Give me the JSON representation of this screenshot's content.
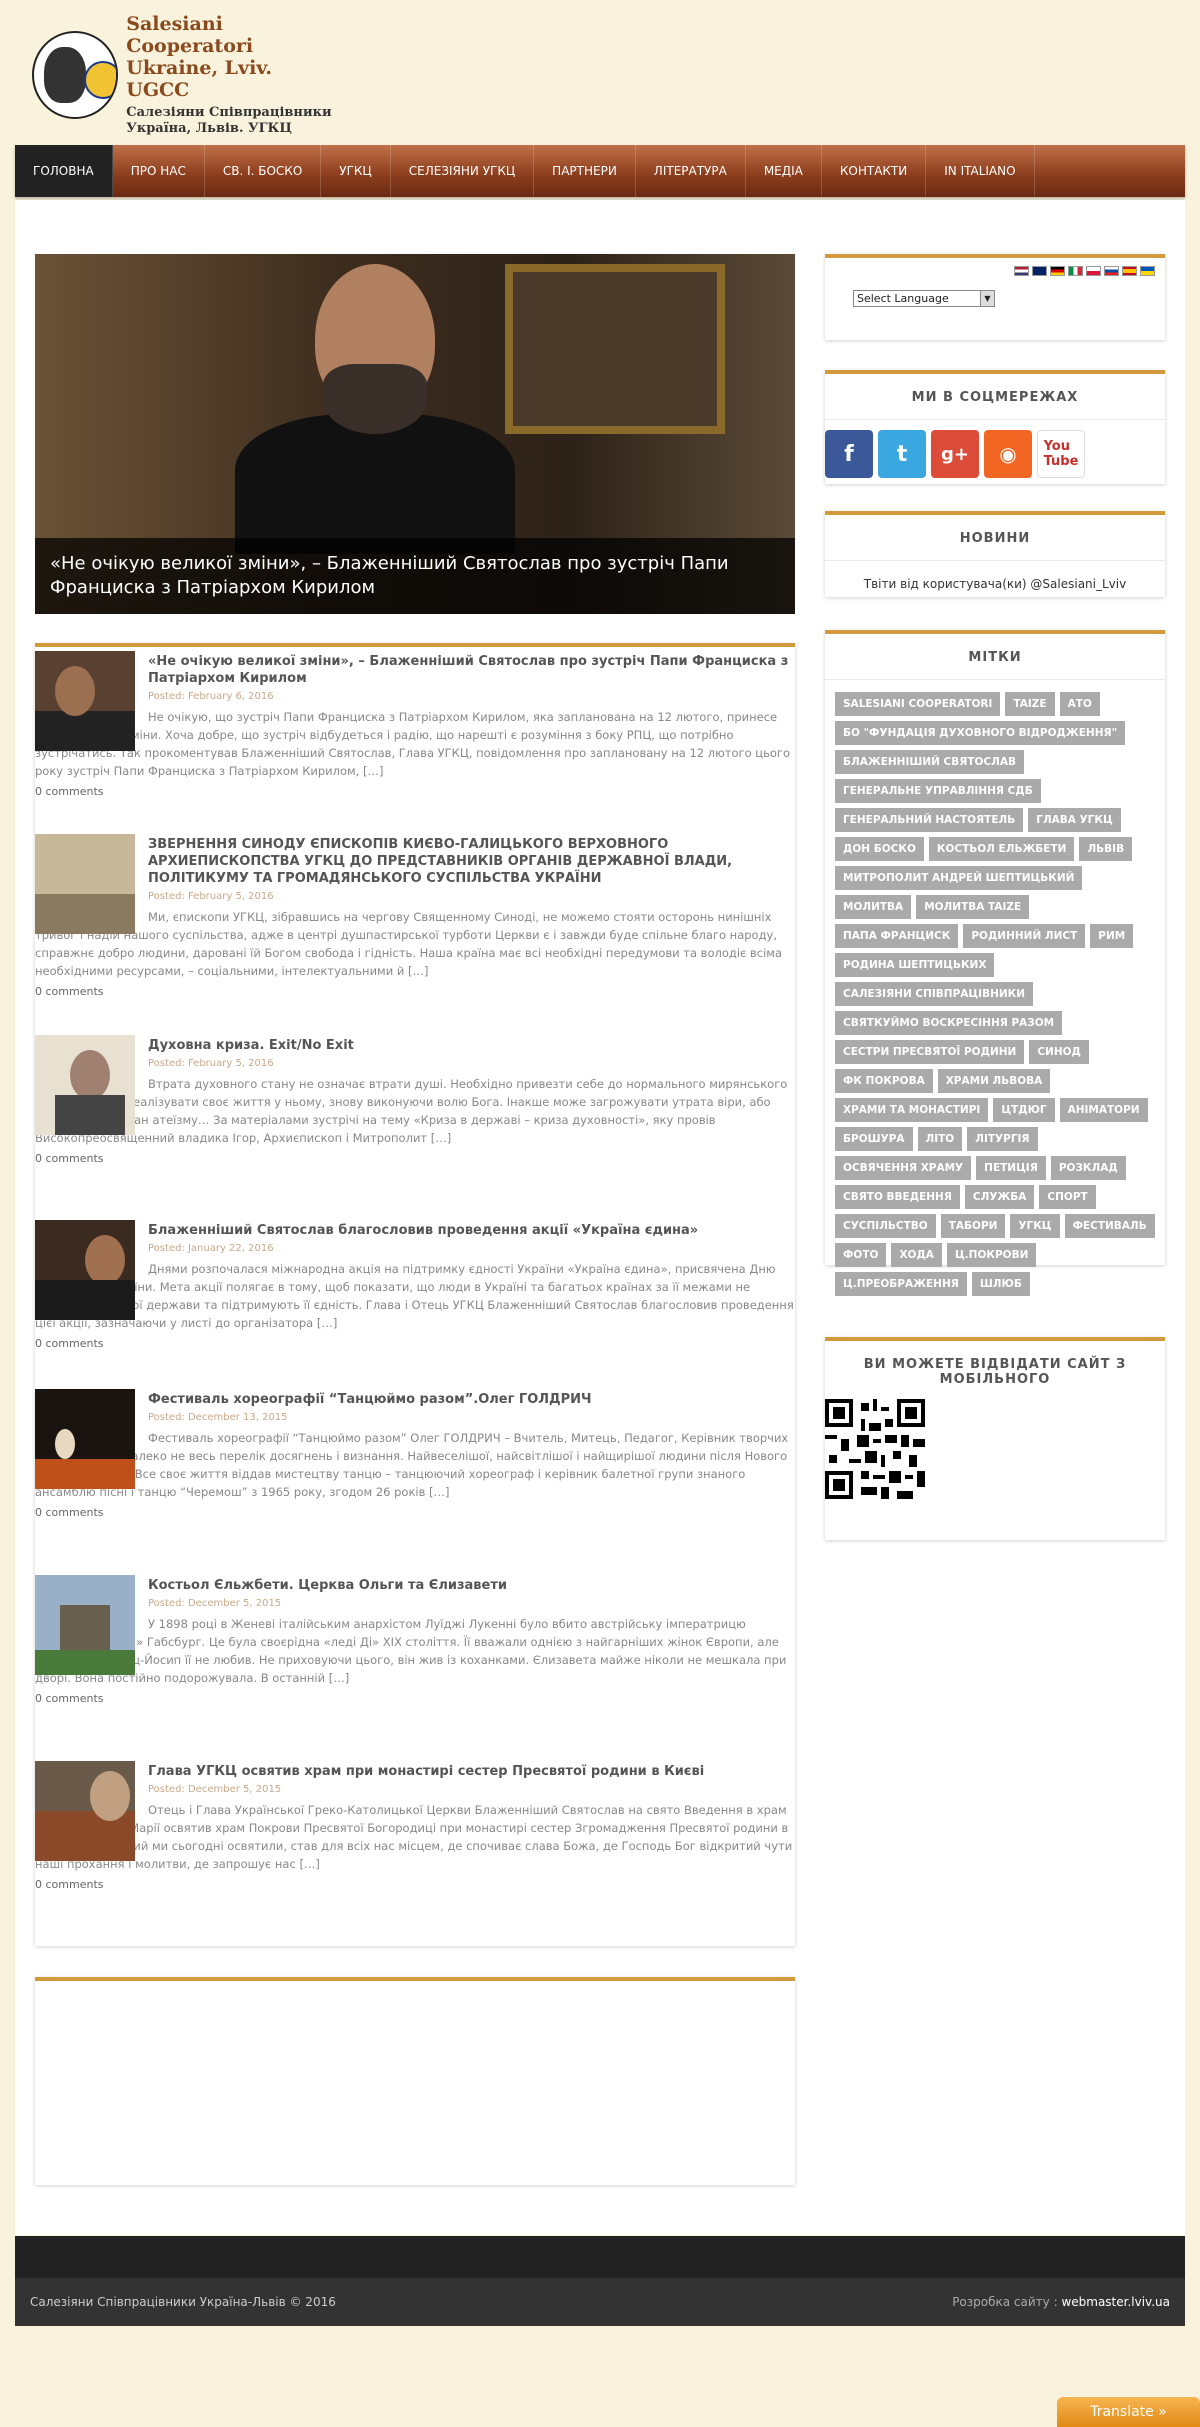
{
  "logo": {
    "line1": "Salesiani Cooperatori",
    "line2": "Ukraine, Lviv.  UGCC",
    "line3": "Салезіяни Співпрацівники",
    "line4": "Україна, Львів.  УГКЦ"
  },
  "nav": [
    "ГОЛОВНА",
    "ПРО НАС",
    "СВ. І. БОСКО",
    "УГКЦ",
    "СЕЛЕЗІЯНИ УГКЦ",
    "ПАРТНЕРИ",
    "ЛІТЕРАТУРА",
    "МЕДІА",
    "КОНТАКТИ",
    "IN ITALIANO"
  ],
  "slider": {
    "caption": "«Не очікую великої зміни», – Блаженніший Святослав про зустріч Папи Франциска з Патріархом Кирилом"
  },
  "posts": [
    {
      "title": "«Не очікую великої зміни», – Блаженніший Святослав про зустріч Папи Франциска з Патріархом Кирилом",
      "date": "Posted: February 6, 2016",
      "excerpt": "Не очікую, що зустріч Папи Франциска з Патріархом Кирилом, яка запланована на 12 лютого, принесе якісь особливі зміни. Хоча добре, що зустріч відбудеться і радію, що нарешті є розуміння з боку РПЦ, що потрібно зустрічатись. Так прокоментував Блаженніший Святослав, Глава УГКЦ, повідомлення про заплановану на 12 лютого цього року зустріч Папи Франциска з Патріархом Кирилом, […]",
      "comments": "0 comments"
    },
    {
      "title": "ЗВЕРНЕННЯ СИНОДУ ЄПИСКОПІВ КИЄВО-ГАЛИЦЬКОГО ВЕРХОВНОГО АРХИЕПИСКОПСТВА УГКЦ ДО ПРЕДСТАВНИКІВ ОРГАНІВ ДЕРЖАВНОЇ ВЛАДИ, ПОЛІТИКУМУ ТА ГРОМАДЯНСЬКОГО СУСПІЛЬСТВА УКРАЇНИ",
      "date": "Posted: February 5, 2016",
      "excerpt": "Ми, єпископи УГКЦ, зібравшись на чергову Священному Синоді, не можемо стояти осторонь нинішніх тривог і надій нашого суспільства, адже в центрі душпастирської турботи Церкви є і завжди буде спільне благо народу, справжнє добро людини, дарованi їй Богом свобода і гідність. Наша країна має всі необхідні передумови та володіє всіма необхідними ресурсами, – соціальними, інтелектуальними й […]",
      "comments": "0 comments"
    },
    {
      "title": "Духовна криза. Exit/No Exit",
      "date": "Posted: February 5, 2016",
      "excerpt": "Втрата духовного стану не означає втрати душі. Необхідно привезти себе до нормального мирянського стану та гідно реалізувати своє життя у ньому, знову виконуючи волю Бога. Інакше може загрожувати утрата віри, або взагалі вхід у стан атеїзму… За матеріалами зустрічі на тему «Криза в державі – криза духовності», яку провів Високопреосвященний владика Ігор, Архиєпископ і Митрополит […]",
      "comments": "0 comments"
    },
    {
      "title": "Блаженніший Святослав благословив проведення акції «Україна єдина»",
      "date": "Posted: January 22, 2016",
      "excerpt": "Днями розпочалася міжнародна акція на підтримку єдності України «Україна єдина», присвячена Дню Соборності України. Мета акції полягає в тому, щоб показати, що люди в Україні та багатьох країнах за її межами не байдужі до нашої держави та підтримують її єдність. Глава і Отець УГКЦ Блаженніший  Святослав благословив проведення цієї акції, зазначаючи у листі до організатора […]",
      "comments": "0 comments"
    },
    {
      "title": "Фестиваль хореографії “Танцюймо разом”.Олег ГОЛДРИЧ",
      "date": "Posted: December 13, 2015",
      "excerpt": "Фестиваль хореографії “Танцюймо разом” Олег ГОЛДРИЧ – Вчитель, Митець, Педагог, Керівник творчих колективів… І далеко не весь перелік досягнень і визнання. Найвеселішої, найсвітлішої і найщирішої людини після Нового важко зустріти. Все своє життя віддав мистецтву танцю – танцюючий хореограф і керівник балетної групи знаного ансамблю пісні і танцю “Черемош” з 1965 року, згодом 26 років […]",
      "comments": "0 comments"
    },
    {
      "title": "Костьол Єльжбети. Церква Ольги та Єлизавети",
      "date": "Posted: December 5, 2015",
      "excerpt": "У 1898 році в Женеві італійським анархістом Луїджі Лукенні було вбито австрійську імператрицю Єлизавету «Сіссі» Габсбург. Це була своєрідна «леді Ді» XIX століття. Її вважали однією з найгарніших жінок Європи, але імператор Франц-Йосип її не любив. Не приховуючи цього, він жив із коханками. Єлизавета майже ніколи не мешкала при дворі. Вона постійно подорожувала. В останній […]",
      "comments": "0 comments"
    },
    {
      "title": "Глава УГКЦ освятив храм при монастирі сестер Пресвятої родини в Києві",
      "date": "Posted: December 5, 2015",
      "excerpt": "Отець і Глава Української Греко-Католицької Церкви Блаженніший Святослав на свято Введення в храм Пречистої Діви Марії освятив храм Покрови Пресвятої Богородиці при монастирі сестер Згромадження Пресвятої родини в Києві. «Храм, який ми сьогодні освятили, став для всіх нас місцем, де спочиває слава Божа, де Господь Бог відкритий чути наші прохання і молитви, де запрошує нас […]",
      "comments": "0 comments"
    }
  ],
  "sidebar": {
    "language_select": "Select Language",
    "social_title": "МИ В СОЦМЕРЕЖАХ",
    "news_title": "НОВИНИ",
    "news_text": "Твіти від користувача(ки) @Salesiani_Lviv",
    "tags_title": "МІТКИ",
    "tags": [
      "SALESIANI COOPERATORI",
      "TAIZE",
      "АТО",
      "БО \"ФУНДАЦІЯ ДУХОВНОГО ВІДРОДЖЕННЯ\"",
      "БЛАЖЕННІШИЙ СВЯТОСЛАВ",
      "ГЕНЕРАЛЬНЕ УПРАВЛІННЯ СДБ",
      "ГЕНЕРАЛЬНИЙ НАСТОЯТЕЛЬ",
      "ГЛАВА УГКЦ",
      "ДОН БОСКО",
      "КОСТЬОЛ ЕЛЬЖБЕТИ",
      "ЛЬВІВ",
      "МИТРОПОЛИТ АНДРЕЙ ШЕПТИЦЬКИЙ",
      "МОЛИТВА",
      "МОЛИТВА TAIZE",
      "ПАПА ФРАНЦИСК",
      "РОДИННИЙ ЛИСТ",
      "РИМ",
      "РОДИНА ШЕПТИЦЬКИХ",
      "САЛЕЗІЯНИ СПІВПРАЦІВНИКИ",
      "СВЯТКУЙМО ВОСКРЕСІННЯ РАЗОМ",
      "СЕСТРИ ПРЕСВЯТОЇ РОДИНИ",
      "СИНОД",
      "ФК ПОКРОВА",
      "ХРАМИ ЛЬВОВА",
      "ХРАМИ ТА МОНАСТИРІ",
      "ЦТДЮГ",
      "АНІМАТОРИ",
      "БРОШУРА",
      "ЛІТО",
      "ЛІТУРГІЯ",
      "ОСВЯЧЕННЯ ХРАМУ",
      "ПЕТИЦІЯ",
      "РОЗКЛАД",
      "СВЯТО ВВЕДЕННЯ",
      "СЛУЖБА",
      "СПОРТ",
      "СУСПІЛЬСТВО",
      "ТАБОРИ",
      "УГКЦ",
      "ФЕСТИВАЛЬ",
      "ФОТО",
      "ХОДА",
      "Ц.ПОКРОВИ",
      "Ц.ПРЕОБРАЖЕННЯ",
      "ШЛЮБ"
    ],
    "mobile_title": "ВИ МОЖЕТЕ ВІДВІДАТИ САЙТ З МОБІЛЬНОГО"
  },
  "footer": {
    "copyright": "Салезіяни Співпрацівники Україна-Львів  © 2016",
    "dev_label": "Розробка сайту : ",
    "dev_link": "webmaster.lviv.ua"
  },
  "translate_button": "Translate »",
  "colors": {
    "accent": "#d39a3b",
    "nav": "#8e3f1e",
    "tag": "#aaaaaa"
  }
}
